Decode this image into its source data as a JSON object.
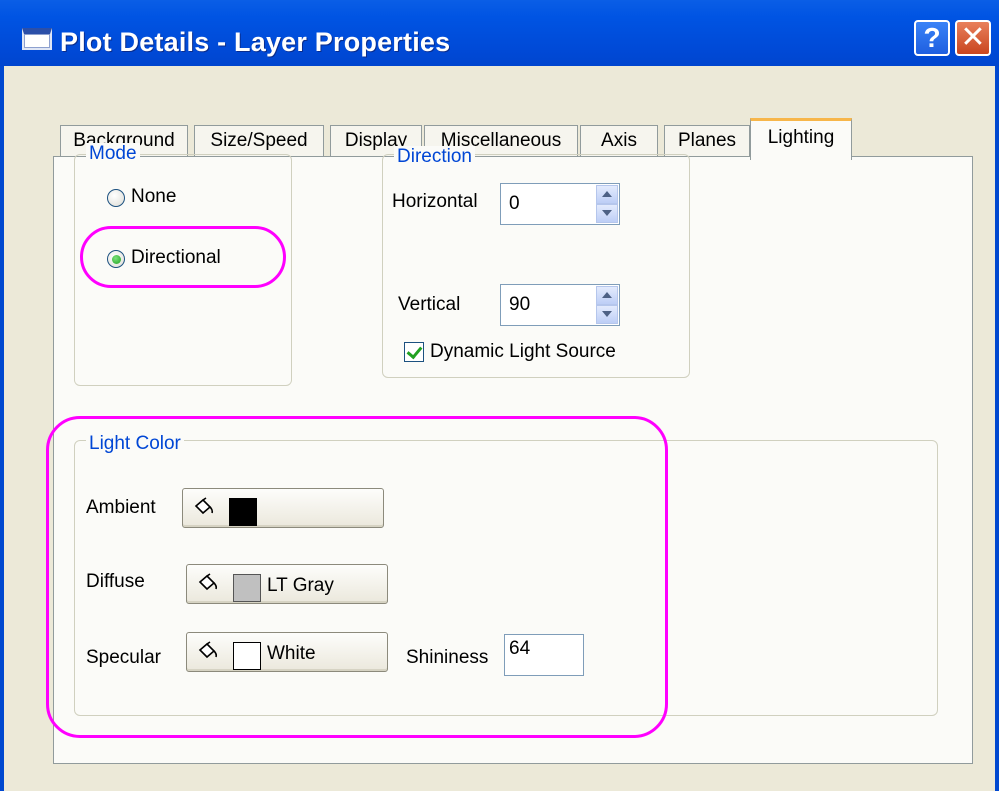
{
  "window": {
    "title": "Plot Details - Layer Properties",
    "help_label": "?",
    "close_label": "✕"
  },
  "tabs": [
    {
      "label": "Background"
    },
    {
      "label": "Size/Speed"
    },
    {
      "label": "Display"
    },
    {
      "label": "Miscellaneous"
    },
    {
      "label": "Axis"
    },
    {
      "label": "Planes"
    },
    {
      "label": "Lighting",
      "active": true
    }
  ],
  "mode": {
    "legend": "Mode",
    "options": [
      {
        "label": "None",
        "selected": false
      },
      {
        "label": "Directional",
        "selected": true
      }
    ]
  },
  "direction": {
    "legend": "Direction",
    "horizontal_label": "Horizontal",
    "horizontal_value": "0",
    "vertical_label": "Vertical",
    "vertical_value": "90",
    "dynamic_label": "Dynamic Light Source",
    "dynamic_checked": true
  },
  "light_color": {
    "legend": "Light Color",
    "ambient": {
      "label": "Ambient",
      "color": "#000000",
      "name": ""
    },
    "diffuse": {
      "label": "Diffuse",
      "color": "#c0c0c0",
      "name": "LT Gray"
    },
    "specular": {
      "label": "Specular",
      "color": "#ffffff",
      "name": "White"
    },
    "shininess_label": "Shininess",
    "shininess_value": "64"
  },
  "colors": {
    "highlight": "#ff00ff",
    "legend_text": "#0046d5",
    "active_tab_accent": "#f7b64a"
  }
}
